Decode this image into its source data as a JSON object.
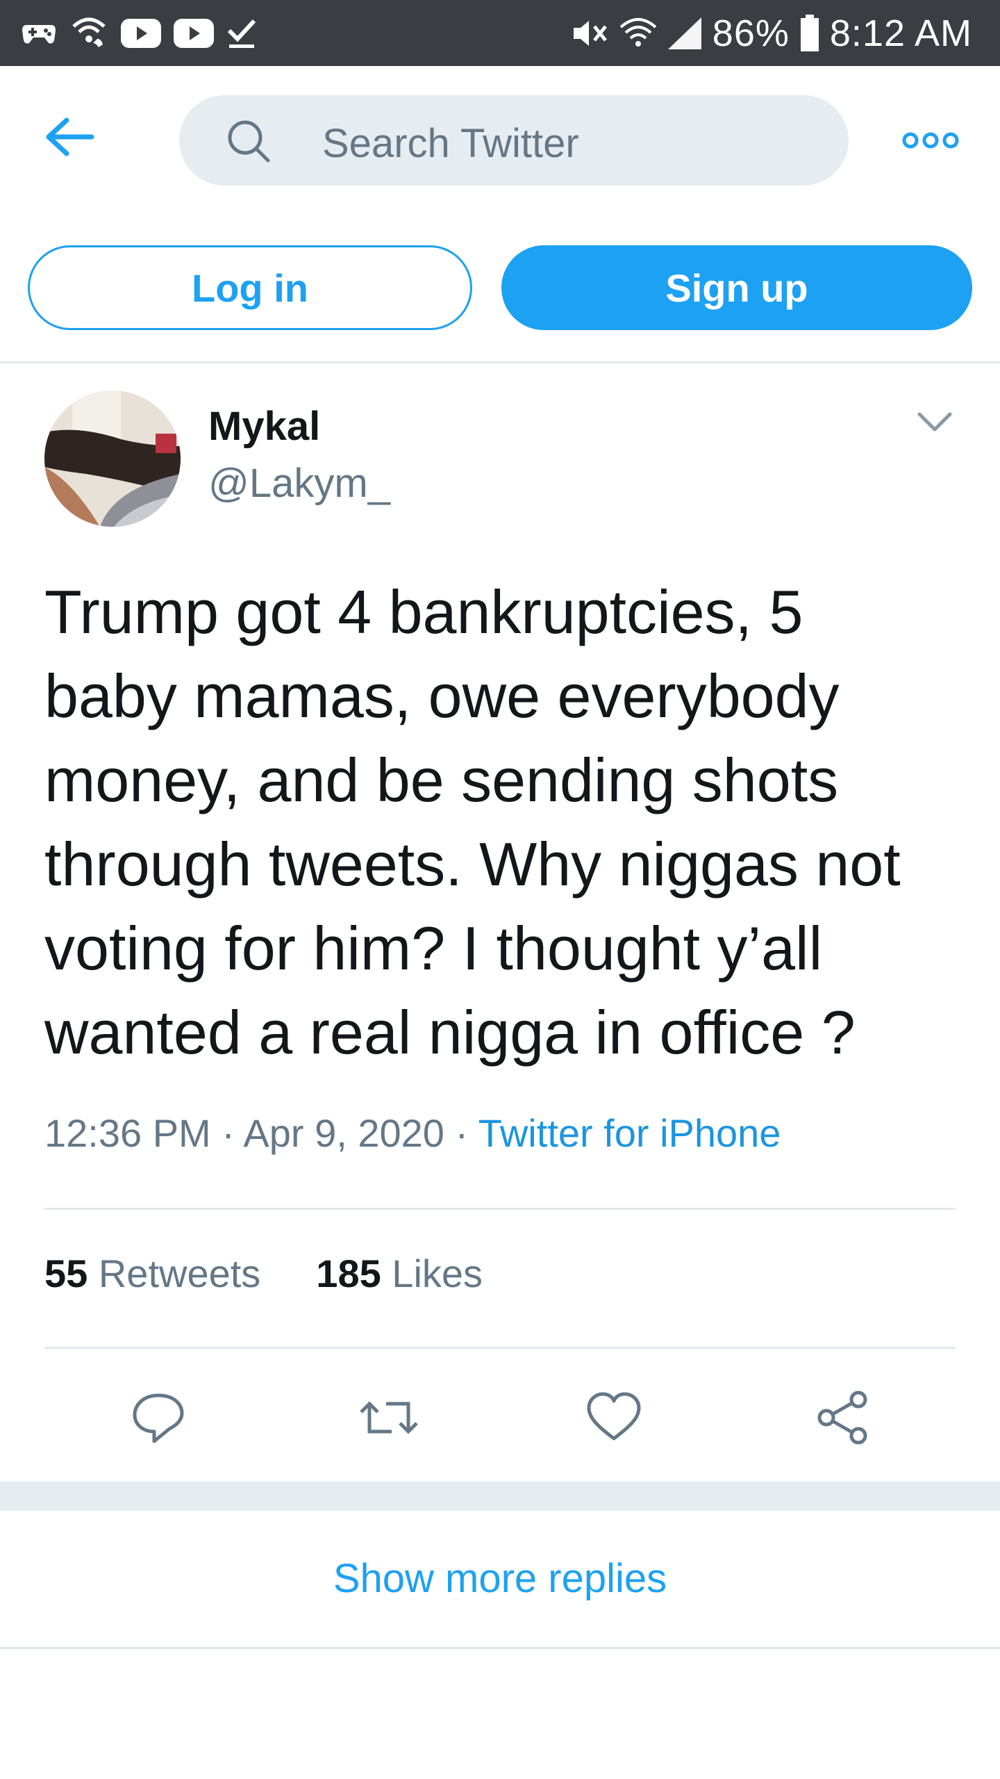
{
  "status_bar": {
    "battery_percent": "86%",
    "time": "8:12 AM",
    "icons_left": [
      "gamepad-icon",
      "wifi-call-icon",
      "youtube-icon",
      "youtube-icon",
      "checkmark-icon"
    ],
    "icons_right": [
      "mute-icon",
      "wifi-icon",
      "signal-icon",
      "battery-icon"
    ]
  },
  "header": {
    "search_placeholder": "Search Twitter"
  },
  "auth": {
    "login_label": "Log in",
    "signup_label": "Sign up"
  },
  "tweet": {
    "author_name": "Mykal",
    "author_handle": "@Lakym_",
    "text": "Trump got 4 bankruptcies, 5\nbaby mamas, owe everybody\nmoney, and be sending shots\nthrough tweets. Why niggas not\nvoting for him? I thought y’all\nwanted a real nigga in office ?",
    "time": "12:36 PM",
    "date": "Apr 9, 2020",
    "source": "Twitter for iPhone",
    "retweet_count": "55",
    "retweet_label": "Retweets",
    "like_count": "185",
    "like_label": "Likes"
  },
  "footer": {
    "show_more_label": "Show more replies"
  },
  "colors": {
    "accent": "#1da1f2",
    "status_bar": "#3a3d42",
    "secondary_text": "#657786",
    "divider": "#e1e8ed"
  }
}
